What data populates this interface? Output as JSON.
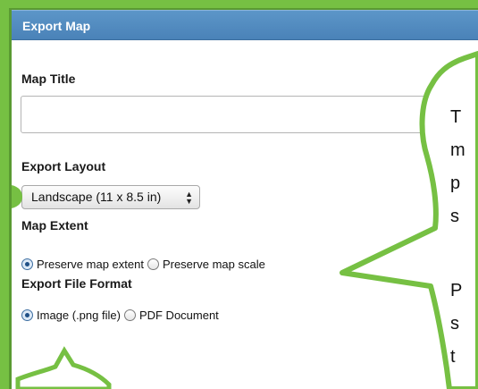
{
  "dialog": {
    "title": "Export Map",
    "map_title": {
      "label": "Map Title",
      "value": "",
      "placeholder": ""
    },
    "export_layout": {
      "label": "Export Layout",
      "selected": "Landscape (11 x 8.5 in)"
    },
    "map_extent": {
      "label": "Map Extent",
      "options": [
        {
          "label": "Preserve map extent",
          "checked": true
        },
        {
          "label": "Preserve map scale",
          "checked": false
        }
      ]
    },
    "export_file_format": {
      "label": "Export File Format",
      "options": [
        {
          "label": "Image (.png file)",
          "checked": true
        },
        {
          "label": "PDF Document",
          "checked": false
        }
      ]
    }
  },
  "callout": {
    "fragments": [
      "T",
      "m",
      "p",
      "s",
      "P",
      "s",
      "t"
    ]
  },
  "colors": {
    "highlight_green": "#76c043",
    "titlebar_blue": "#4f89bf"
  }
}
